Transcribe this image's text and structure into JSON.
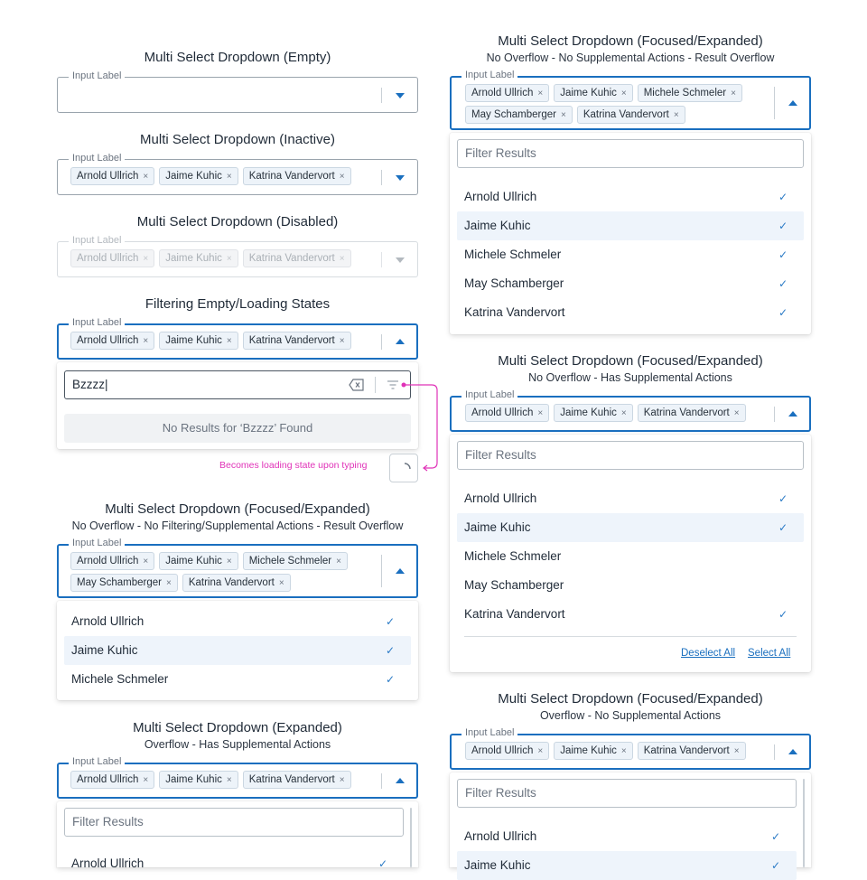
{
  "chip_x": "×",
  "check": "✓",
  "s1": {
    "title": "Multi Select Dropdown (Empty)",
    "label": "Input Label"
  },
  "s2": {
    "title": "Multi Select Dropdown (Inactive)",
    "label": "Input Label",
    "chips": [
      "Arnold Ullrich",
      "Jaime Kuhic",
      "Katrina Vandervort"
    ]
  },
  "s3": {
    "title": "Multi Select Dropdown (Disabled)",
    "label": "Input Label",
    "chips": [
      "Arnold Ullrich",
      "Jaime Kuhic",
      "Katrina Vandervort"
    ]
  },
  "s4": {
    "title": "Filtering Empty/Loading States",
    "label": "Input Label",
    "chips": [
      "Arnold Ullrich",
      "Jaime Kuhic",
      "Katrina Vandervort"
    ],
    "filter_value": "Bzzzz|",
    "no_results": "No Results for ‘Bzzzz’ Found",
    "annotation": "Becomes loading state upon typing"
  },
  "s5": {
    "title": "Multi Select Dropdown (Focused/Expanded)",
    "subtitle": "No Overflow - No Filtering/Supplemental Actions - Result Overflow",
    "label": "Input Label",
    "chips": [
      "Arnold Ullrich",
      "Jaime Kuhic",
      "Michele Schmeler",
      "May Schamberger",
      "Katrina Vandervort"
    ],
    "options": [
      "Arnold Ullrich",
      "Jaime Kuhic",
      "Michele Schmeler"
    ]
  },
  "s6": {
    "title": "Multi Select Dropdown (Expanded)",
    "subtitle": "Overflow - Has Supplemental Actions",
    "label": "Input Label",
    "chips": [
      "Arnold Ullrich",
      "Jaime Kuhic",
      "Katrina Vandervort"
    ],
    "filter_placeholder": "Filter Results",
    "options": [
      "Arnold Ullrich"
    ]
  },
  "r1": {
    "title": "Multi Select Dropdown (Focused/Expanded)",
    "subtitle": "No Overflow - No Supplemental Actions - Result Overflow",
    "label": "Input Label",
    "chips": [
      "Arnold Ullrich",
      "Jaime Kuhic",
      "Michele Schmeler",
      "May Schamberger",
      "Katrina Vandervort"
    ],
    "filter_placeholder": "Filter Results",
    "options": [
      "Arnold Ullrich",
      "Jaime Kuhic",
      "Michele Schmeler",
      "May Schamberger",
      "Katrina Vandervort"
    ]
  },
  "r2": {
    "title": "Multi Select Dropdown (Focused/Expanded)",
    "subtitle": "No Overflow - Has Supplemental Actions",
    "label": "Input Label",
    "chips": [
      "Arnold Ullrich",
      "Jaime Kuhic",
      "Katrina Vandervort"
    ],
    "filter_placeholder": "Filter Results",
    "options": [
      "Arnold Ullrich",
      "Jaime Kuhic",
      "Michele Schmeler",
      "May Schamberger",
      "Katrina Vandervort"
    ],
    "deselect_all": "Deselect All",
    "select_all": "Select All"
  },
  "r3": {
    "title": "Multi Select Dropdown (Focused/Expanded)",
    "subtitle": "Overflow - No Supplemental Actions",
    "label": "Input Label",
    "chips": [
      "Arnold Ullrich",
      "Jaime Kuhic",
      "Katrina Vandervort"
    ],
    "filter_placeholder": "Filter Results",
    "options": [
      "Arnold Ullrich",
      "Jaime Kuhic"
    ]
  }
}
